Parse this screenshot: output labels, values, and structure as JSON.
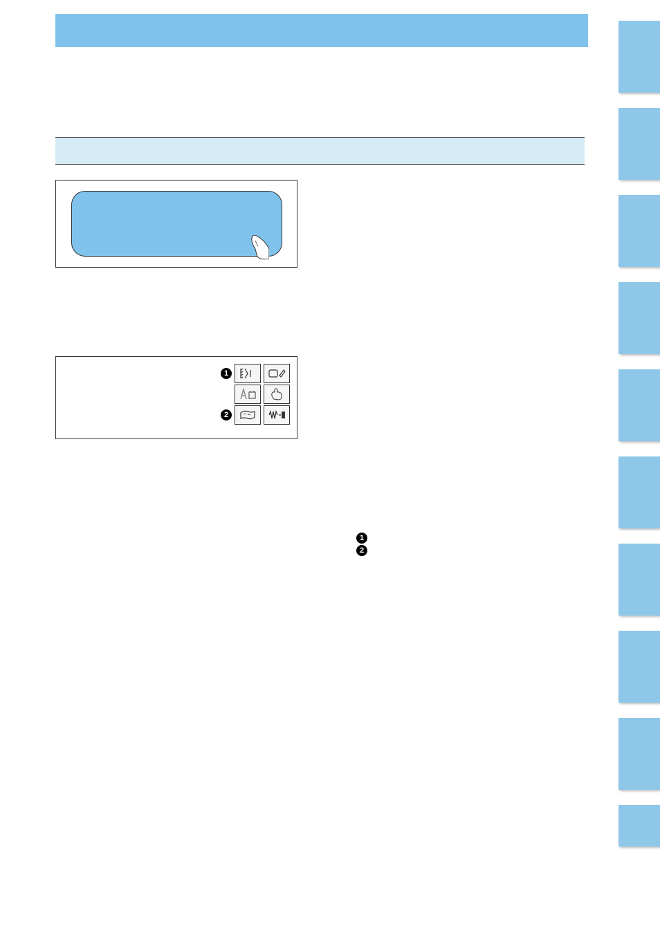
{
  "header": {
    "title": ""
  },
  "section_banner": {
    "label": ""
  },
  "figure1": {
    "description": "Touch screen display being tapped by finger"
  },
  "figure2": {
    "row1_label": "1",
    "row3_label": "2",
    "icons": {
      "r1c1": "stitch-pattern-icon",
      "r1c2": "edit-draw-icon",
      "r2c1": "text-font-icon",
      "r2c2": "hand-select-icon",
      "r3c1": "fabric-layer-icon",
      "r3c2": "wave-stitch-icon"
    }
  },
  "callouts": {
    "item1": {
      "num": "1",
      "text": ""
    },
    "item2": {
      "num": "2",
      "text": ""
    }
  },
  "side_tabs": [
    "",
    "",
    "",
    "",
    "",
    "",
    "",
    "",
    "",
    ""
  ]
}
